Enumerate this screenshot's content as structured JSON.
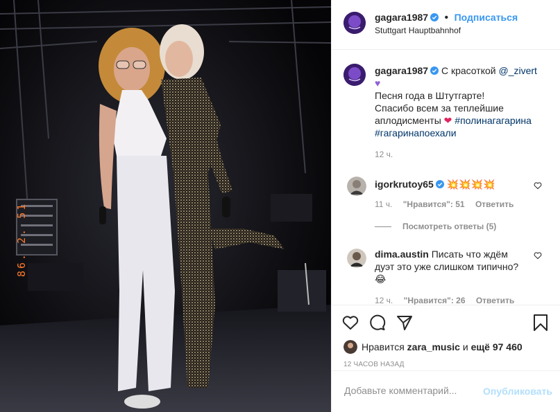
{
  "header": {
    "username": "gagara1987",
    "follow_label": "Подписаться",
    "separator": "•",
    "location": "Stuttgart Hauptbahnhof"
  },
  "photo": {
    "date_stamp": "86. 2. 51"
  },
  "caption": {
    "username": "gagara1987",
    "text_before_mention": "С красоткой ",
    "mention": "@_zivert",
    "line2": "Песня года в Штутгарте!",
    "line3": "Спасибо всем за теплейшие",
    "line4": "аплодисменты",
    "hashtag1": "#полинагагарина",
    "hashtag2": "#гагаринапоехали",
    "time": "12 ч."
  },
  "comments": [
    {
      "username": "igorkrutoy65",
      "text": "💥💥💥💥",
      "time": "11 ч.",
      "likes_label": "\"Нравится\": 51",
      "reply_label": "Ответить",
      "view_replies": "Посмотреть ответы (5)"
    },
    {
      "username": "dima.austin",
      "text_line1": "Писать что ждём",
      "text_line2": "дуэт это уже слишком типично?",
      "text_line3": "😂",
      "time": "12 ч.",
      "likes_label": "\"Нравится\": 26",
      "reply_label": "Ответить"
    }
  ],
  "likes": {
    "prefix": "Нравится",
    "user": "zara_music",
    "connector": "и",
    "others": "ещё 97 460"
  },
  "posted_ago": "12 ЧАСОВ НАЗАД",
  "comment_box": {
    "placeholder": "Добавьте комментарий...",
    "publish_label": "Опубликовать"
  },
  "colors": {
    "accent": "#3897f0",
    "publish_disabled": "#b2dffc",
    "verified": "#3897f0",
    "date_stamp": "#ff7a2a"
  }
}
